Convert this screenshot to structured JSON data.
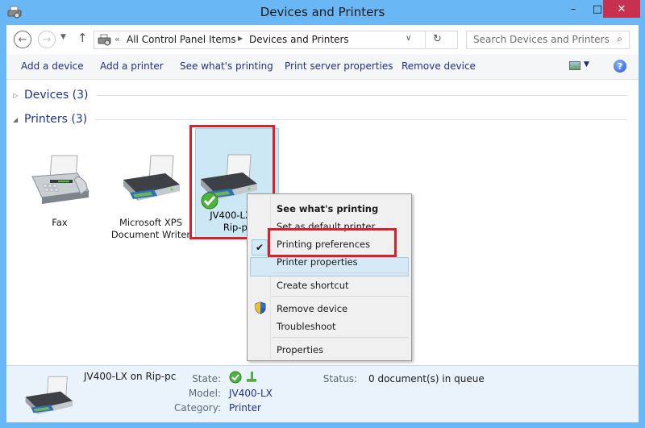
{
  "window": {
    "title": "Devices and Printers",
    "minimize_glyph": "–",
    "maximize_glyph": "□",
    "close_glyph": "✕"
  },
  "nav": {
    "back_glyph": "←",
    "forward_glyph": "→",
    "recent_glyph": "▼",
    "up_glyph": "↑",
    "address_overflow": "«",
    "breadcrumbs": [
      "All Control Panel Items",
      "Devices and Printers"
    ],
    "breadcrumb_separator": "▶",
    "address_dropdown": "∨",
    "refresh_glyph": "↻",
    "search_placeholder": "Search Devices and Printers",
    "search_glyph": "⌕"
  },
  "commands": [
    {
      "label": "Add a device"
    },
    {
      "label": "Add a printer"
    },
    {
      "label": "See what's printing"
    },
    {
      "label": "Print server properties"
    },
    {
      "label": "Remove device"
    }
  ],
  "command_extras": {
    "view_dropdown_glyph": "▼",
    "help_glyph": "?"
  },
  "groups": [
    {
      "label": "Devices (3)",
      "expanded": false,
      "arrow": "▷"
    },
    {
      "label": "Printers (3)",
      "expanded": true,
      "arrow": "◢"
    }
  ],
  "printers": [
    {
      "line1": "Fax",
      "line2": ""
    },
    {
      "line1": "Microsoft XPS",
      "line2": "Document Writer"
    },
    {
      "line1": "JV400-LX on",
      "line2": "Rip-pc",
      "default": true,
      "selected": true
    }
  ],
  "context_menu": {
    "items": [
      {
        "label": "See what's printing",
        "bold": true
      },
      {
        "label": "Set as default printer",
        "checked": true
      },
      {
        "label": "Printing preferences",
        "highlighted": true
      },
      {
        "label": "Printer properties"
      },
      {
        "label": "Create shortcut"
      },
      {
        "label": "Remove device",
        "icon": "uac-shield-icon"
      },
      {
        "label": "Troubleshoot"
      },
      {
        "label": "Properties"
      }
    ],
    "check_glyph": "✔"
  },
  "details": {
    "name": "JV400-LX on Rip-pc",
    "state_label": "State:",
    "model_label": "Model:",
    "model_value": "JV400-LX",
    "category_label": "Category:",
    "category_value": "Printer",
    "status_label": "Status:",
    "status_value": "0 document(s) in queue"
  },
  "colors": {
    "title_bar": "#6ab7f5",
    "link_text": "#1e3287",
    "selection_fill": "#cce8f5",
    "annotation_red": "#e01e25",
    "close_button": "#c7304e"
  }
}
